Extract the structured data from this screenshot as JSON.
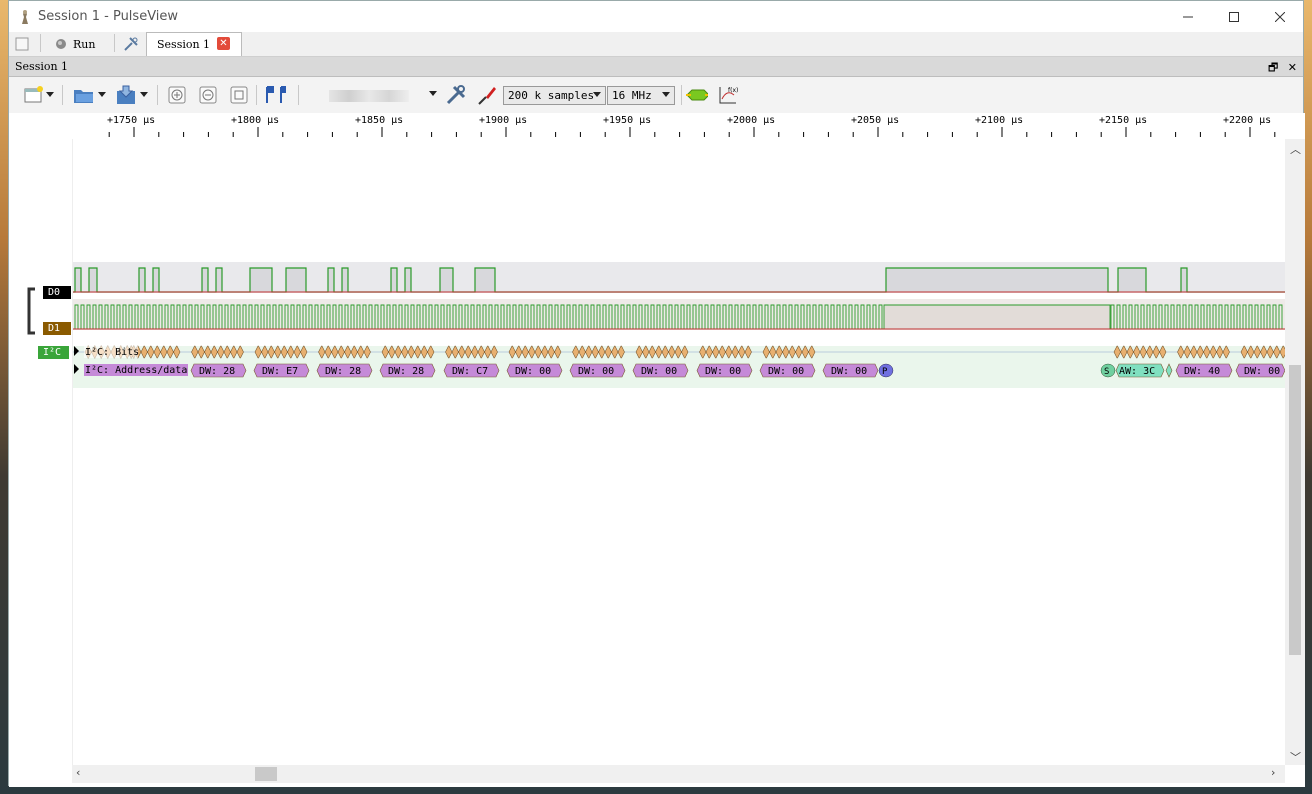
{
  "window": {
    "title": "Session 1 - PulseView"
  },
  "tabrow": {
    "run_label": "Run",
    "session_tab_label": "Session 1"
  },
  "session": {
    "title": "Session 1"
  },
  "toolbar": {
    "samples": "200 k samples",
    "samplerate": "16 MHz"
  },
  "ruler": {
    "labels": [
      "+1750 µs",
      "+1800 µs",
      "+1850 µs",
      "+1900 µs",
      "+1950 µs",
      "+2000 µs",
      "+2050 µs",
      "+2100 µs",
      "+2150 µs",
      "+2200 µs"
    ]
  },
  "channels": [
    {
      "name": "D0",
      "color": "#000000"
    },
    {
      "name": "D1",
      "color": "#8a5a00"
    }
  ],
  "decoder": {
    "name": "I²C",
    "color": "#3aa53a",
    "rows": [
      "I²C: Bits",
      "I²C: Address/data"
    ],
    "annotations": [
      "DW: 28",
      "DW: E7",
      "DW: 28",
      "DW: 28",
      "DW: C7",
      "DW: 00",
      "DW: 00",
      "DW: 00",
      "DW: 00",
      "DW: 00",
      "DW: 00",
      "P",
      "S",
      "AW: 3C",
      "DW: 40",
      "DW: 00"
    ]
  },
  "colors": {
    "trace_high": "#2a9a2a",
    "trace_low": "#c03030",
    "bit_fill": "#e8b070",
    "addr_fill": "#c58ad8",
    "stop_fill": "#7070e0",
    "start_fill": "#70d0a0"
  }
}
